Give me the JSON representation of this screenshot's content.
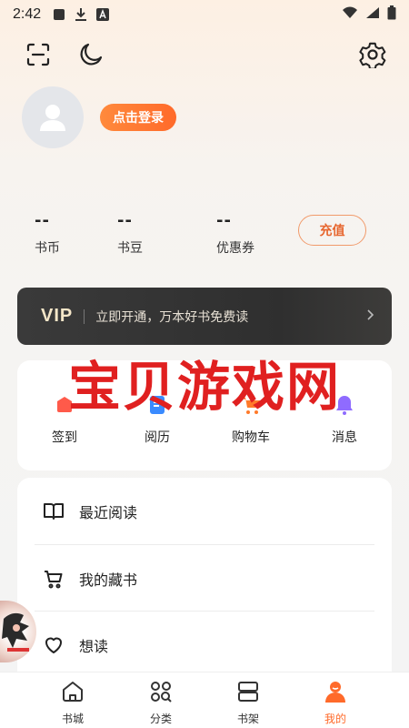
{
  "status_bar": {
    "time": "2:42"
  },
  "profile": {
    "login_label": "点击登录"
  },
  "stats": [
    {
      "value": "--",
      "label": "书币"
    },
    {
      "value": "--",
      "label": "书豆"
    },
    {
      "value": "--",
      "label": "优惠券"
    }
  ],
  "recharge_label": "充值",
  "vip": {
    "logo": "VIP",
    "text": "立即开通，万本好书免费读"
  },
  "tools": [
    {
      "label": "签到",
      "icon": "checkin-icon"
    },
    {
      "label": "阅历",
      "icon": "history-icon"
    },
    {
      "label": "购物车",
      "icon": "cart-icon"
    },
    {
      "label": "消息",
      "icon": "bell-icon"
    }
  ],
  "watermark": "宝贝游戏网",
  "list": [
    {
      "label": "最近阅读",
      "icon": "book-open-icon"
    },
    {
      "label": "我的藏书",
      "icon": "cart-icon"
    },
    {
      "label": "想读",
      "icon": "heart-icon"
    }
  ],
  "tabs": [
    {
      "label": "书城",
      "icon": "home-icon"
    },
    {
      "label": "分类",
      "icon": "category-icon"
    },
    {
      "label": "书架",
      "icon": "bookshelf-icon"
    },
    {
      "label": "我的",
      "icon": "profile-icon"
    }
  ],
  "colors": {
    "accent": "#ff6a2a",
    "vip_bg": "#333333",
    "watermark": "#e02020"
  }
}
